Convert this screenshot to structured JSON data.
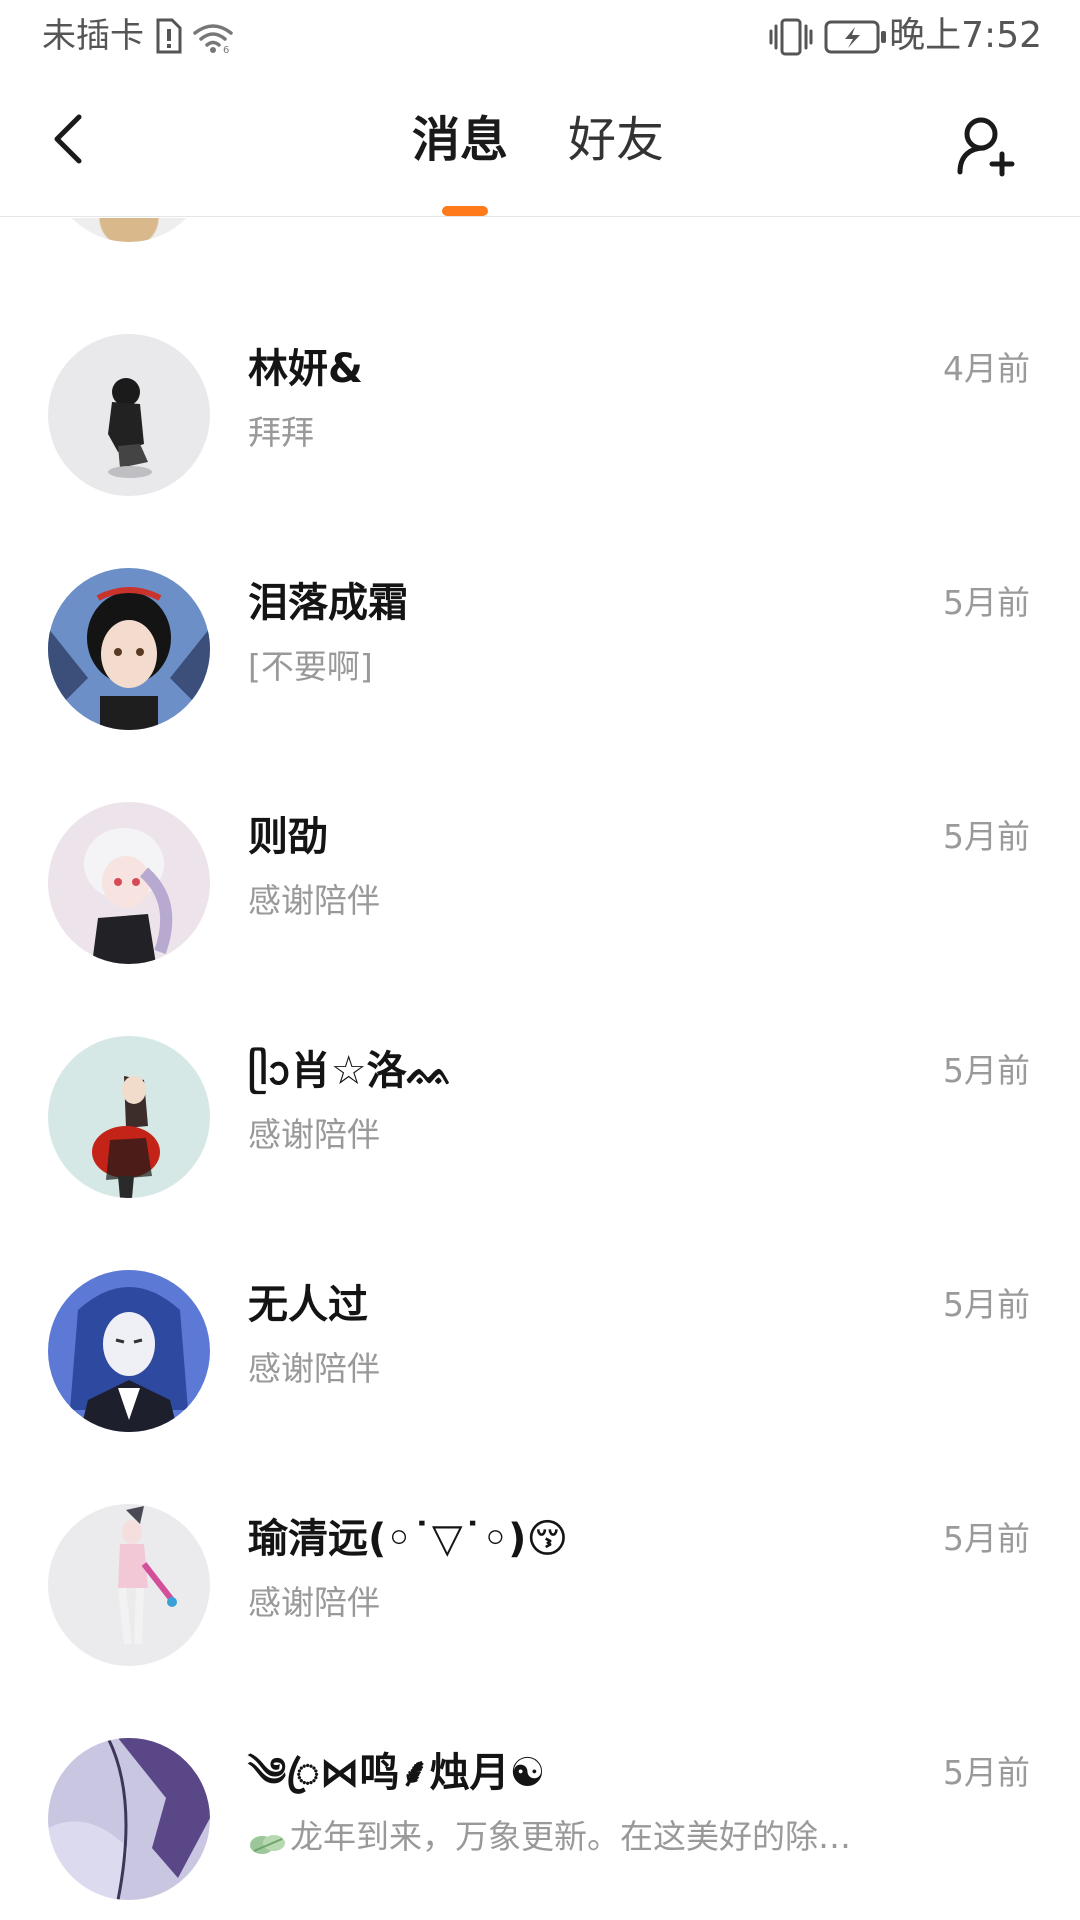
{
  "status_bar": {
    "carrier": "未插卡",
    "time": "晚上7:52"
  },
  "header": {
    "tabs": [
      {
        "label": "消息",
        "active": true
      },
      {
        "label": "好友",
        "active": false
      }
    ],
    "accent_color": "#ff7a1a"
  },
  "messages": [
    {
      "name": "林妍&",
      "preview": "拜拜",
      "time": "4月前"
    },
    {
      "name": "泪落成霜",
      "preview": "[不要啊]",
      "time": "5月前"
    },
    {
      "name": "则劭",
      "preview": "感谢陪伴",
      "time": "5月前"
    },
    {
      "name": "ᥫᩣ肖☆洛ᨐ",
      "preview": "感谢陪伴",
      "time": "5月前"
    },
    {
      "name": "无人过",
      "preview": "感谢陪伴",
      "time": "5月前"
    },
    {
      "name": "瑜清远(◦˙▽˙◦)😚",
      "preview": "感谢陪伴",
      "time": "5月前"
    },
    {
      "name": "༄ꦿ⋈鸣⸙烛月☯",
      "preview": "龙年到来，万象更新。在这美好的除…",
      "time": "5月前"
    }
  ]
}
